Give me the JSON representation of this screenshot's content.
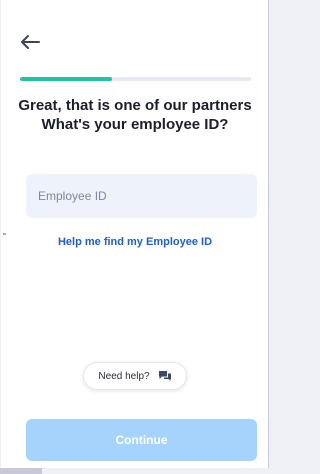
{
  "progress": {
    "fraction": 0.4
  },
  "heading": {
    "line1": "Great, that is one of our partners",
    "line2": "What's your employee ID?"
  },
  "employee_id": {
    "placeholder": "Employee ID",
    "value": ""
  },
  "help_link": {
    "label": "Help me find my Employee ID"
  },
  "need_help": {
    "label": "Need help?",
    "icon": "chat-bubbles-icon"
  },
  "continue": {
    "label": "Continue",
    "enabled": false
  },
  "colors": {
    "accent": "#22c3a0",
    "link": "#1f5fc8",
    "button_disabled": "#a6d3fb",
    "input_bg": "#eef2fa"
  }
}
